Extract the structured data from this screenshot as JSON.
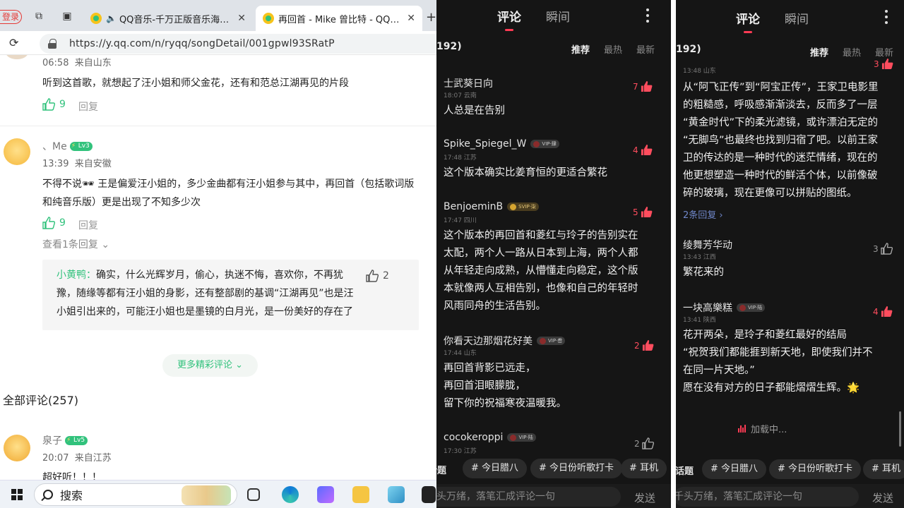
{
  "browser": {
    "login_tab": "登录",
    "tabs": [
      {
        "title": "QQ音乐-千万正版音乐海量无损曲库新歌热歌天天畅听的高品质音乐平台！"
      },
      {
        "title": "再回首 - Mike 曾比特 - QQ音乐-千万正版音乐海量无损曲库"
      }
    ],
    "new_tab": "+",
    "close_glyph": "✕",
    "url": "https://y.qq.com/n/ryqq/songDetail/001gpwl93SRatP"
  },
  "page": {
    "comment0": {
      "time": "06:58",
      "location": "来自山东",
      "text": "听到这首歌，就想起了汪小姐和师父金花，还有和范总江湖再见的片段",
      "likes": "9",
      "reply": "回复"
    },
    "comment1": {
      "user": "、Me",
      "level": "Lv3",
      "time": "13:39",
      "location": "来自安徽",
      "text_line1": "不得不说🕶 王是偏爱汪小姐的，多少金曲都有汪小姐参与其中，再回首（包括歌词版",
      "text_line2": "和纯音乐版）更是出现了不知多少次",
      "likes": "9",
      "reply": "回复",
      "view_replies": "查看1条回复",
      "sub_reply": {
        "user": "小黄鸭：",
        "likes": "2",
        "line1": "确实，什么光辉岁月，偷心，执迷不悔，喜欢你，不再犹",
        "line2": "豫，随缘等都有汪小姐的身影，还有整部剧的基调“江湖再见”也是汪",
        "line3": "小姐引出来的，可能汪小姐也是墨镜的白月光，是一份美好的存在了"
      }
    },
    "more_comments": "更多精彩评论",
    "all_comments": "全部评论(257)",
    "comment2": {
      "user": "泉子",
      "level": "Lv5",
      "time": "20:07",
      "location": "来自江苏",
      "text": "超好听！！！"
    }
  },
  "taskbar": {
    "search_label": "搜索"
  },
  "phone1": {
    "tabs": [
      "评论",
      "瞬间"
    ],
    "count": "192)",
    "sort": [
      "推荐",
      "最热",
      "最新"
    ],
    "comments": [
      {
        "user": "士武葵日向",
        "meta": "18:07 云南",
        "text": "人总是在告别",
        "likes": "7"
      },
      {
        "user": "Spike_Spiegel_W",
        "badge": "VIP·肆",
        "meta": "17:48 江苏",
        "text": "这个版本确实比姜育恒的更适合繁花",
        "likes": "4"
      },
      {
        "user": "BenjoeminB",
        "badge": "SVIP·柒",
        "meta": "17:47 四川",
        "lines": [
          "这个版本的再回首和菱红与玲子的告别实在",
          "太配，两个人一路从日本到上海，两个人都",
          "从年轻走向成熟，从懵懂走向稳定，这个版",
          "本就像两人互相告别，也像和自己的年轻时",
          "风雨同舟的生活告别。"
        ],
        "likes": "5"
      },
      {
        "user": "你看天边那烟花好美",
        "badge": "VIP·叁",
        "meta": "17:44 山东",
        "lines": [
          "再回首背影已远走，",
          "再回首泪眼朦胧，",
          "留下你的祝福寒夜温暖我。"
        ],
        "likes": "2"
      },
      {
        "user": "cocokeroppi",
        "badge": "VIP·陆",
        "meta": "17:30 江苏",
        "likes": "2"
      }
    ],
    "tag_start": "话题",
    "tags": [
      "# 今日腊八",
      "# 今日份听歌打卡",
      "# 耳机"
    ],
    "input_placeholder": "千头万绪，落笔汇成评论一句",
    "send": "发送"
  },
  "phone2": {
    "tabs": [
      "评论",
      "瞬间"
    ],
    "count": "192)",
    "sort": [
      "推荐",
      "最热",
      "最新"
    ],
    "top_meta": "13:48 山东",
    "top_likes": "3",
    "top_lines": [
      "从“阿飞正传”到“阿宝正传”，王家卫电影里",
      "的粗糙感，呼吸感渐渐淡去，反而多了一层",
      "“黄金时代”下的柔光滤镜，或许漂泊无定的",
      "“无脚鸟”也最终也找到归宿了吧。以前王家",
      "卫的传达的是一种时代的迷茫情绪，现在的",
      "他更想塑造一种时代的鲜活个体，以前像破",
      "碎的玻璃，现在更像可以拼贴的图纸。"
    ],
    "replies_link": "2条回复",
    "comments": [
      {
        "user": "绫舞芳华动",
        "meta": "13:43 江西",
        "text": "繁花来的",
        "likes": "3"
      },
      {
        "user": "一块高樂糕",
        "badge": "VIP·陆",
        "meta": "13:41 陕西",
        "lines": [
          "花开两朵，是玲子和菱红最好的结局",
          "“祝贺我们都能捱到新天地，即使我们并不",
          "在同一片天地。”",
          "愿在没有对方的日子都能熠熠生辉。🌟"
        ],
        "likes": "4"
      }
    ],
    "loading": "加载中...",
    "tag_start": "话题",
    "tags": [
      "# 今日腊八",
      "# 今日份听歌打卡",
      "# 耳机"
    ],
    "input_placeholder": "千头万绪，落笔汇成评论一句",
    "send": "发送"
  }
}
